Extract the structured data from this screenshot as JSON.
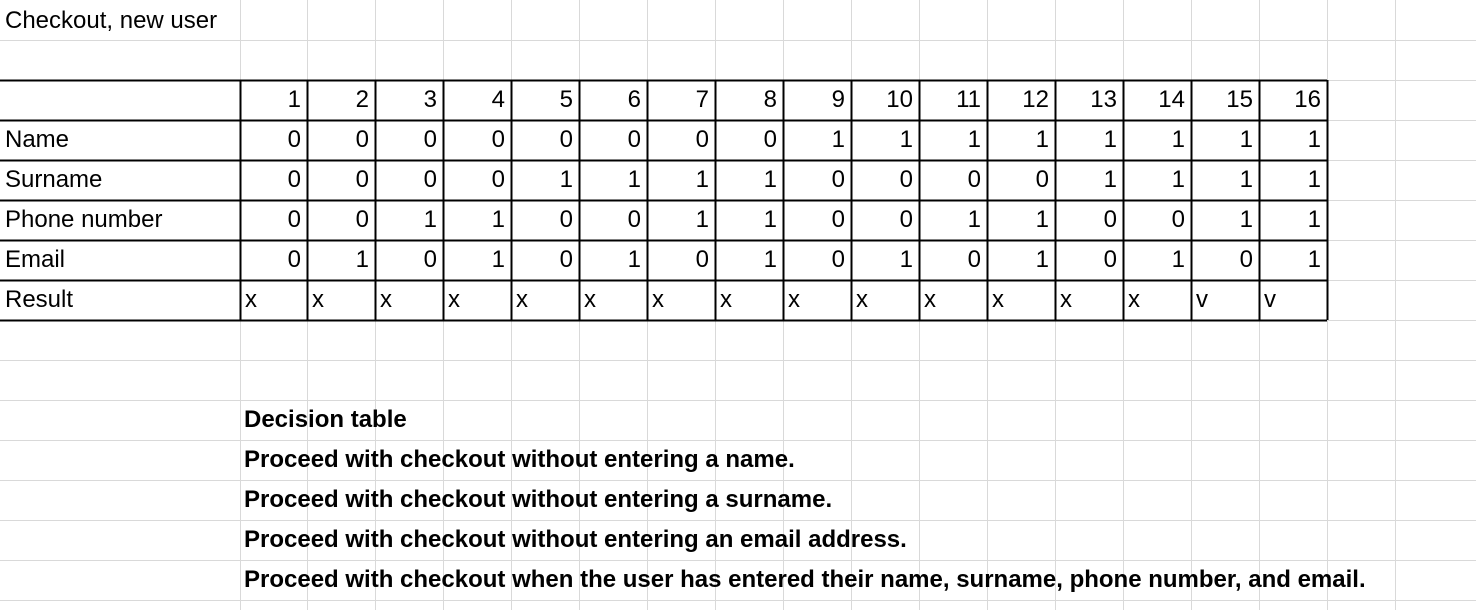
{
  "sheet_title": "Checkout, new user",
  "colors": {
    "gridline": "#d9d9d9",
    "table_border": "#000000",
    "text": "#000000",
    "background": "#ffffff"
  },
  "decision_table": {
    "columns": [
      "1",
      "2",
      "3",
      "4",
      "5",
      "6",
      "7",
      "8",
      "9",
      "10",
      "11",
      "12",
      "13",
      "14",
      "15",
      "16"
    ],
    "rows": [
      {
        "label": "Name",
        "values": [
          "0",
          "0",
          "0",
          "0",
          "0",
          "0",
          "0",
          "0",
          "1",
          "1",
          "1",
          "1",
          "1",
          "1",
          "1",
          "1"
        ]
      },
      {
        "label": "Surname",
        "values": [
          "0",
          "0",
          "0",
          "0",
          "1",
          "1",
          "1",
          "1",
          "0",
          "0",
          "0",
          "0",
          "1",
          "1",
          "1",
          "1"
        ]
      },
      {
        "label": "Phone number",
        "values": [
          "0",
          "0",
          "1",
          "1",
          "0",
          "0",
          "1",
          "1",
          "0",
          "0",
          "1",
          "1",
          "0",
          "0",
          "1",
          "1"
        ]
      },
      {
        "label": "Email",
        "values": [
          "0",
          "1",
          "0",
          "1",
          "0",
          "1",
          "0",
          "1",
          "0",
          "1",
          "0",
          "1",
          "0",
          "1",
          "0",
          "1"
        ]
      }
    ],
    "result": {
      "label": "Result",
      "values": [
        "x",
        "x",
        "x",
        "x",
        "x",
        "x",
        "x",
        "x",
        "x",
        "x",
        "x",
        "x",
        "x",
        "x",
        "v",
        "v"
      ]
    }
  },
  "notes": [
    "Decision table",
    "Proceed with checkout without entering a name.",
    "Proceed with checkout without entering a surname.",
    "Proceed with checkout without entering an email address.",
    "Proceed with checkout when the user has entered their name, surname, phone number, and email."
  ]
}
